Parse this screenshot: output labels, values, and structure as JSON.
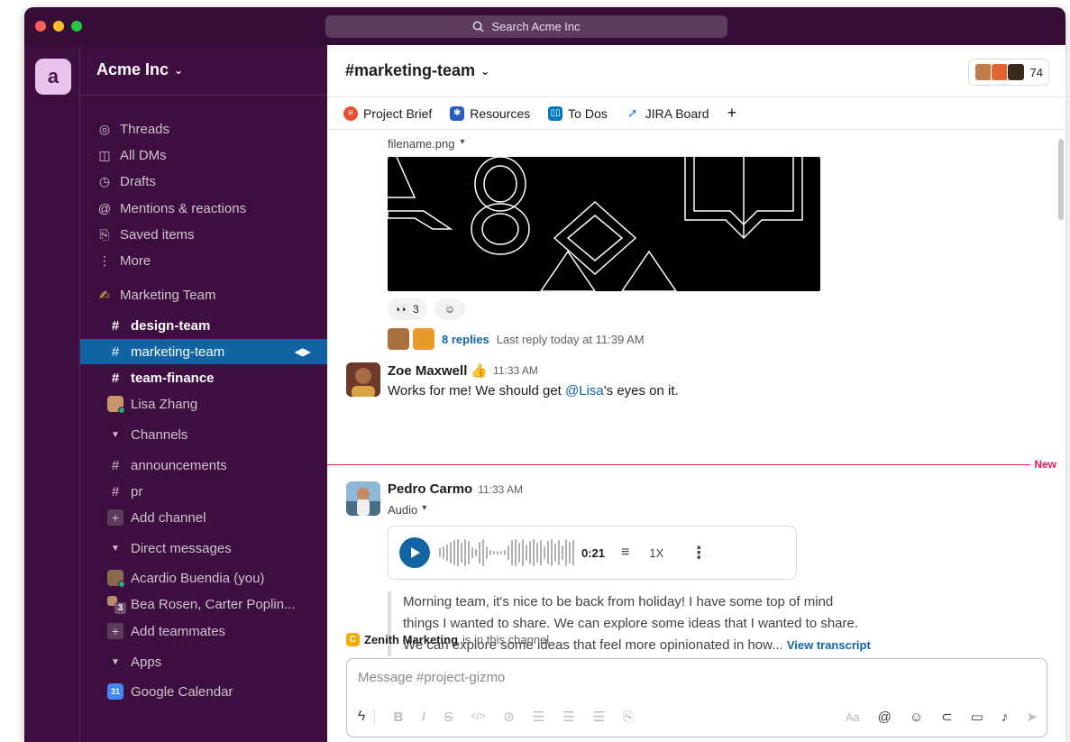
{
  "search": {
    "placeholder": "Search Acme Inc"
  },
  "workspace": {
    "initial": "a",
    "name": "Acme Inc",
    "caret": "⌄"
  },
  "sidebar": {
    "nav": [
      {
        "icon": "threads-icon",
        "glyph": "◎",
        "label": "Threads"
      },
      {
        "icon": "dms-icon",
        "glyph": "◫",
        "label": "All DMs"
      },
      {
        "icon": "drafts-icon",
        "glyph": "◷",
        "label": "Drafts"
      },
      {
        "icon": "mentions-icon",
        "glyph": "@",
        "label": "Mentions & reactions"
      },
      {
        "icon": "bookmark-icon",
        "glyph": "⎘",
        "label": "Saved items"
      },
      {
        "icon": "more-icon",
        "glyph": "⋮",
        "label": "More"
      }
    ],
    "section_marketing": {
      "emoji": "✍",
      "label": "Marketing Team"
    },
    "marketing_channels": [
      {
        "label": "design-team",
        "bold": true,
        "active": false
      },
      {
        "label": "marketing-team",
        "bold": false,
        "active": true
      },
      {
        "label": "team-finance",
        "bold": true,
        "active": false
      }
    ],
    "lisa": {
      "label": "Lisa Zhang"
    },
    "channels_header": "Channels",
    "channels": [
      {
        "label": "announcements"
      },
      {
        "label": "pr"
      }
    ],
    "add_channel": "Add channel",
    "dms_header": "Direct messages",
    "dms": [
      {
        "label": "Acardio Buendia (you)"
      },
      {
        "label": "Bea Rosen, Carter Poplin...",
        "badge": "3"
      }
    ],
    "add_teammates": "Add teammates",
    "apps_header": "Apps",
    "apps": [
      {
        "label": "Google Calendar",
        "glyph": "31"
      }
    ]
  },
  "channel": {
    "name": "#marketing-team",
    "caret": "⌄",
    "member_count": "74",
    "bookmarks": [
      {
        "label": "Project Brief",
        "icon": "project-brief-icon",
        "color": "#e8502f"
      },
      {
        "label": "Resources",
        "icon": "resources-icon",
        "color": "#2b5cc1"
      },
      {
        "label": "To Dos",
        "icon": "todos-icon",
        "color": "#0079bf"
      },
      {
        "label": "JIRA Board",
        "icon": "jira-icon",
        "color": "#2684ff"
      }
    ],
    "add_bookmark": "+"
  },
  "messages": {
    "file": {
      "name": "filename.png",
      "caret": "▾"
    },
    "reaction_eyes": {
      "emoji": "👀",
      "count": "3"
    },
    "reply_summary": {
      "count_label": "8 replies",
      "last_reply": "Last reply today at 11:39 AM"
    },
    "zoe": {
      "name": "Zoe Maxwell",
      "emoji": "👍",
      "time": "11:33 AM",
      "text_pre": "Works for me! We should get ",
      "mention": "@Lisa",
      "text_post": "'s eyes on it."
    },
    "new_label": "New",
    "pedro": {
      "name": "Pedro Carmo",
      "time": "11:33 AM",
      "attachment_label": "Audio",
      "duration": "0:21",
      "speed": "1X",
      "transcript": [
        "Morning team, it's nice to be back from holiday! I have some top of mind",
        "things I wanted to share. We can explore some ideas that I wanted to share.",
        "We can explore some ideas that feel more opinionated in how..."
      ],
      "view_transcript": "View transcript"
    },
    "zenith": {
      "name": "Zenith Marketing",
      "suffix": "is in this channel"
    }
  },
  "composer": {
    "placeholder": "Message #project-gizmo"
  },
  "colors": {
    "aubergine": "#3f0e40",
    "titlebar": "#350d36",
    "active": "#1164a3",
    "new_line": "#e01e5a",
    "link": "#1264a3"
  }
}
